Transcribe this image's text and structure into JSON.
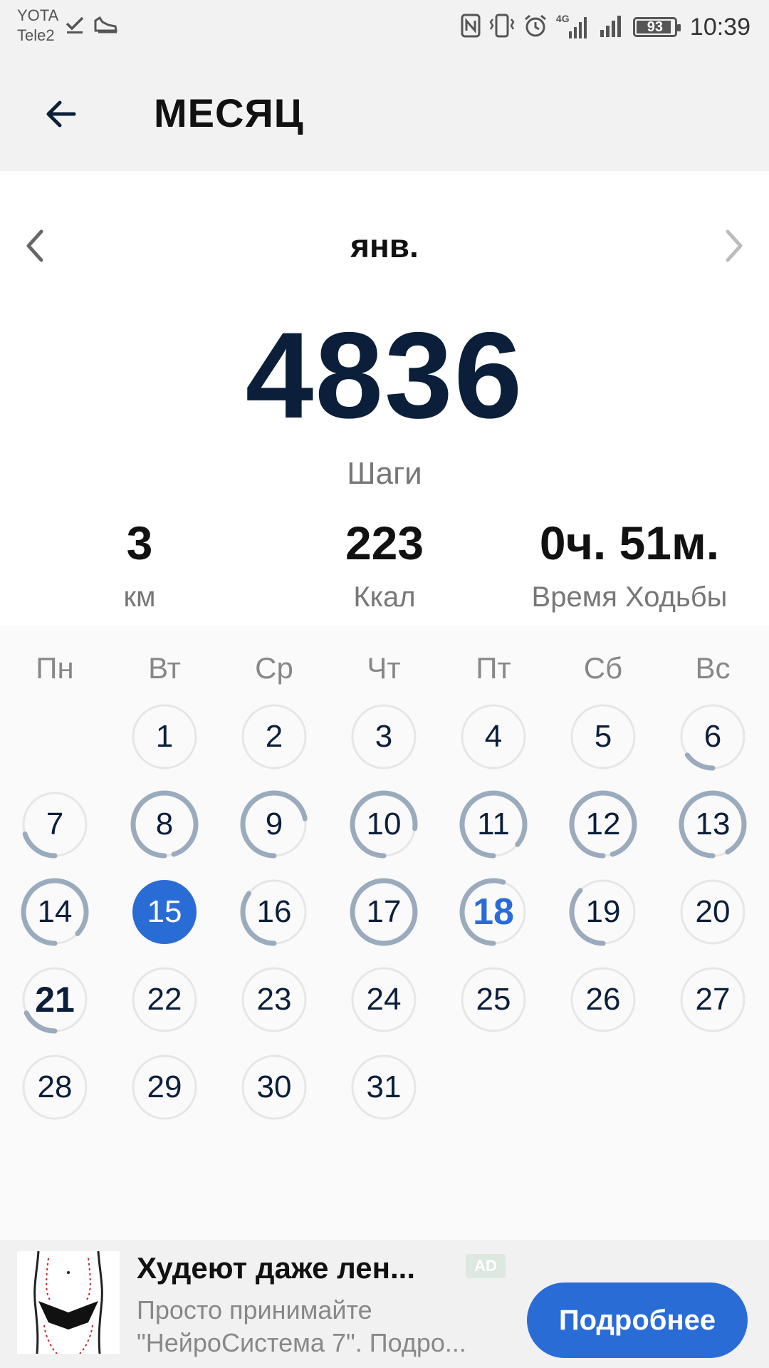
{
  "status_bar": {
    "carrier_1": "YOTA",
    "carrier_2": "Tele2",
    "left_icons": [
      "download-done-icon",
      "shoe-icon"
    ],
    "right_icons": [
      "nfc-icon",
      "vibrate-icon",
      "alarm-icon",
      "signal-4g-icon",
      "signal-icon"
    ],
    "network_label": "4G",
    "battery_level": "93",
    "battery_fraction": 0.93,
    "time": "10:39"
  },
  "app_bar": {
    "back_icon": "arrow-left-icon",
    "title": "МЕСЯЦ"
  },
  "summary": {
    "month": "янв.",
    "prev_icon": "chevron-left-icon",
    "next_icon": "chevron-right-icon",
    "steps": "4836",
    "steps_label": "Шаги",
    "stats": [
      {
        "value": "3",
        "label": "км"
      },
      {
        "value": "223",
        "label": "Ккал"
      },
      {
        "value": "0ч. 51м.",
        "label": "Время Ходьбы"
      }
    ]
  },
  "calendar": {
    "weekdays": [
      "Пн",
      "Вт",
      "Ср",
      "Чт",
      "Пт",
      "Сб",
      "Вс"
    ],
    "first_weekday_index": 1,
    "days": [
      {
        "label": "1",
        "progress": 0
      },
      {
        "label": "2",
        "progress": 0
      },
      {
        "label": "3",
        "progress": 0
      },
      {
        "label": "4",
        "progress": 0
      },
      {
        "label": "5",
        "progress": 0
      },
      {
        "label": "6",
        "progress": 0.15
      },
      {
        "label": "7",
        "progress": 0.2
      },
      {
        "label": "8",
        "progress": 0.95
      },
      {
        "label": "9",
        "progress": 0.72
      },
      {
        "label": "10",
        "progress": 0.77
      },
      {
        "label": "11",
        "progress": 0.86
      },
      {
        "label": "12",
        "progress": 0.95
      },
      {
        "label": "13",
        "progress": 0.92
      },
      {
        "label": "14",
        "progress": 0.87
      },
      {
        "label": "15",
        "progress": 0,
        "selected": true
      },
      {
        "label": "16",
        "progress": 0.35
      },
      {
        "label": "17",
        "progress": 1.0
      },
      {
        "label": "18",
        "progress": 0.55,
        "today": true
      },
      {
        "label": "19",
        "progress": 0.37
      },
      {
        "label": "20",
        "progress": 0
      },
      {
        "label": "21",
        "progress": 0.18,
        "bold": true
      },
      {
        "label": "22",
        "progress": 0
      },
      {
        "label": "23",
        "progress": 0
      },
      {
        "label": "24",
        "progress": 0
      },
      {
        "label": "25",
        "progress": 0
      },
      {
        "label": "26",
        "progress": 0
      },
      {
        "label": "27",
        "progress": 0
      },
      {
        "label": "28",
        "progress": 0
      },
      {
        "label": "29",
        "progress": 0
      },
      {
        "label": "30",
        "progress": 0
      },
      {
        "label": "31",
        "progress": 0
      }
    ],
    "colors": {
      "ring_bg": "#e6e6e6",
      "ring_progress": "#9aabbd",
      "selected_fill": "#2a6cd6",
      "today_text": "#2a6cd6"
    }
  },
  "ad": {
    "title": "Худеют даже лен...",
    "badge": "AD",
    "description_line_1": "Просто принимайте",
    "description_line_2": "\"НейроСистема 7\". Подро...",
    "cta": "Подробнее",
    "image_icon": "body-silhouette-image"
  }
}
